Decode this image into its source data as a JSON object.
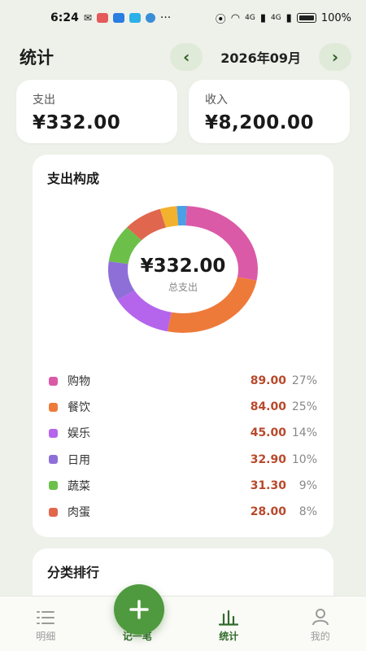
{
  "status_bar": {
    "time": "6:24",
    "signal_1": "4G",
    "signal_2": "4G",
    "battery": "100%"
  },
  "header": {
    "title": "统计",
    "month": "2026年09月",
    "prev_icon": "chevron-left-icon",
    "next_icon": "chevron-right-icon"
  },
  "summary": {
    "expense_label": "支出",
    "expense_value": "¥332.00",
    "income_label": "收入",
    "income_value": "¥8,200.00"
  },
  "composition": {
    "title": "支出构成",
    "total": "¥332.00",
    "total_label": "总支出"
  },
  "chart_data": {
    "type": "pie",
    "categories": [
      "购物",
      "餐饮",
      "娱乐",
      "日用",
      "蔬菜",
      "肉蛋"
    ],
    "values": [
      89.0,
      84.0,
      45.0,
      32.9,
      31.3,
      28.0
    ],
    "percent_labels": [
      "27%",
      "25%",
      "14%",
      "10%",
      "9%",
      "8%"
    ],
    "amount_labels": [
      "89.00",
      "84.00",
      "45.00",
      "32.90",
      "31.30",
      "28.00"
    ],
    "colors": [
      "#db5aa8",
      "#ee7a3a",
      "#b565ec",
      "#8e6fd8",
      "#6cc04a",
      "#e0674e"
    ],
    "extra_values": [
      12.0,
      7.0
    ],
    "extra_colors": [
      "#f2b22e",
      "#4a9fe6"
    ],
    "donut": true
  },
  "ranking": {
    "title": "分类排行"
  },
  "bottom_nav": {
    "items": [
      {
        "label": "明细",
        "icon": "list-icon"
      },
      {
        "label": "记一笔",
        "icon": "plus-icon"
      },
      {
        "label": "统计",
        "icon": "bar-chart-icon"
      },
      {
        "label": "我的",
        "icon": "user-icon"
      }
    ]
  },
  "colors": {
    "accent": "#4f9a3e",
    "amount": "#b8492c",
    "background": "#eef1ea"
  }
}
